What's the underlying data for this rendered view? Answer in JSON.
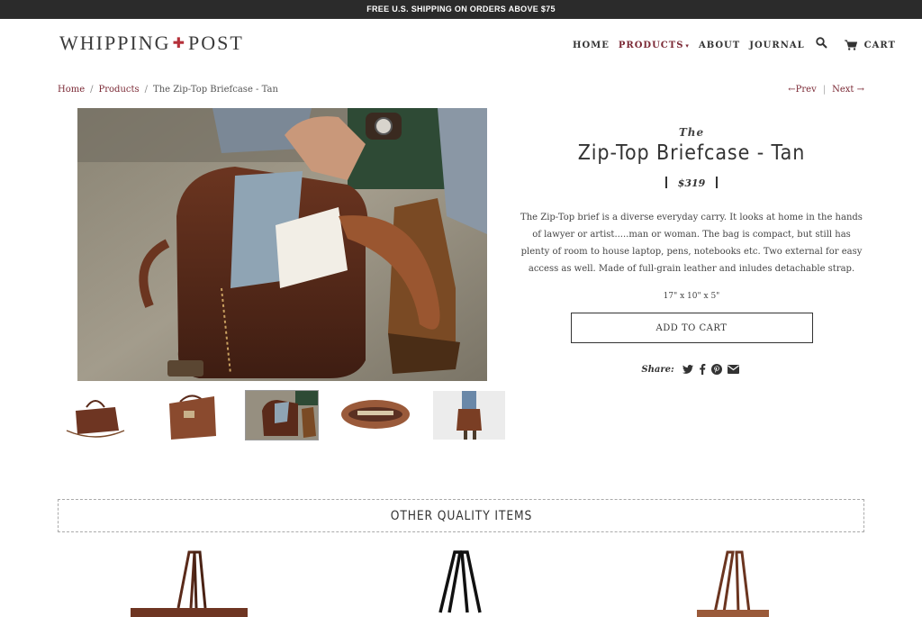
{
  "promo": {
    "text": "FREE U.S. SHIPPING ON ORDERS ABOVE $75"
  },
  "brand": {
    "left": "WHIPPING",
    "mark": "✚",
    "right": "POST",
    "accent": "#b5313a"
  },
  "nav": {
    "home": "HOME",
    "products": "PRODUCTS",
    "about": "ABOUT",
    "journal": "JOURNAL",
    "cart": "CART",
    "active_color": "#7b2935",
    "icons": {
      "search": "search-icon",
      "cart": "cart-icon",
      "caret": "chevron-down-icon"
    }
  },
  "breadcrumb": {
    "home": "Home",
    "products": "Products",
    "current": "The Zip-Top Briefcase - Tan",
    "sep": "/"
  },
  "pager": {
    "prev": "←Prev",
    "next": "Next →"
  },
  "product": {
    "prefix": "The",
    "title": "Zip-Top Briefcase - Tan",
    "price": "$319",
    "description": "The Zip-Top brief is a diverse everyday carry. It looks at home in the hands of lawyer or artist.....man or woman. The bag is compact, but still has plenty of room to house laptop, pens, notebooks etc. Two external for easy access as well. Made of full-grain leather and inludes detachable strap.",
    "dimensions": "17\" x 10\" x 5\"",
    "add_to_cart": "ADD TO CART",
    "share_label": "Share:",
    "share_icons": [
      "twitter-icon",
      "facebook-icon",
      "pinterest-icon",
      "email-icon"
    ]
  },
  "related": {
    "heading": "OTHER QUALITY ITEMS"
  }
}
